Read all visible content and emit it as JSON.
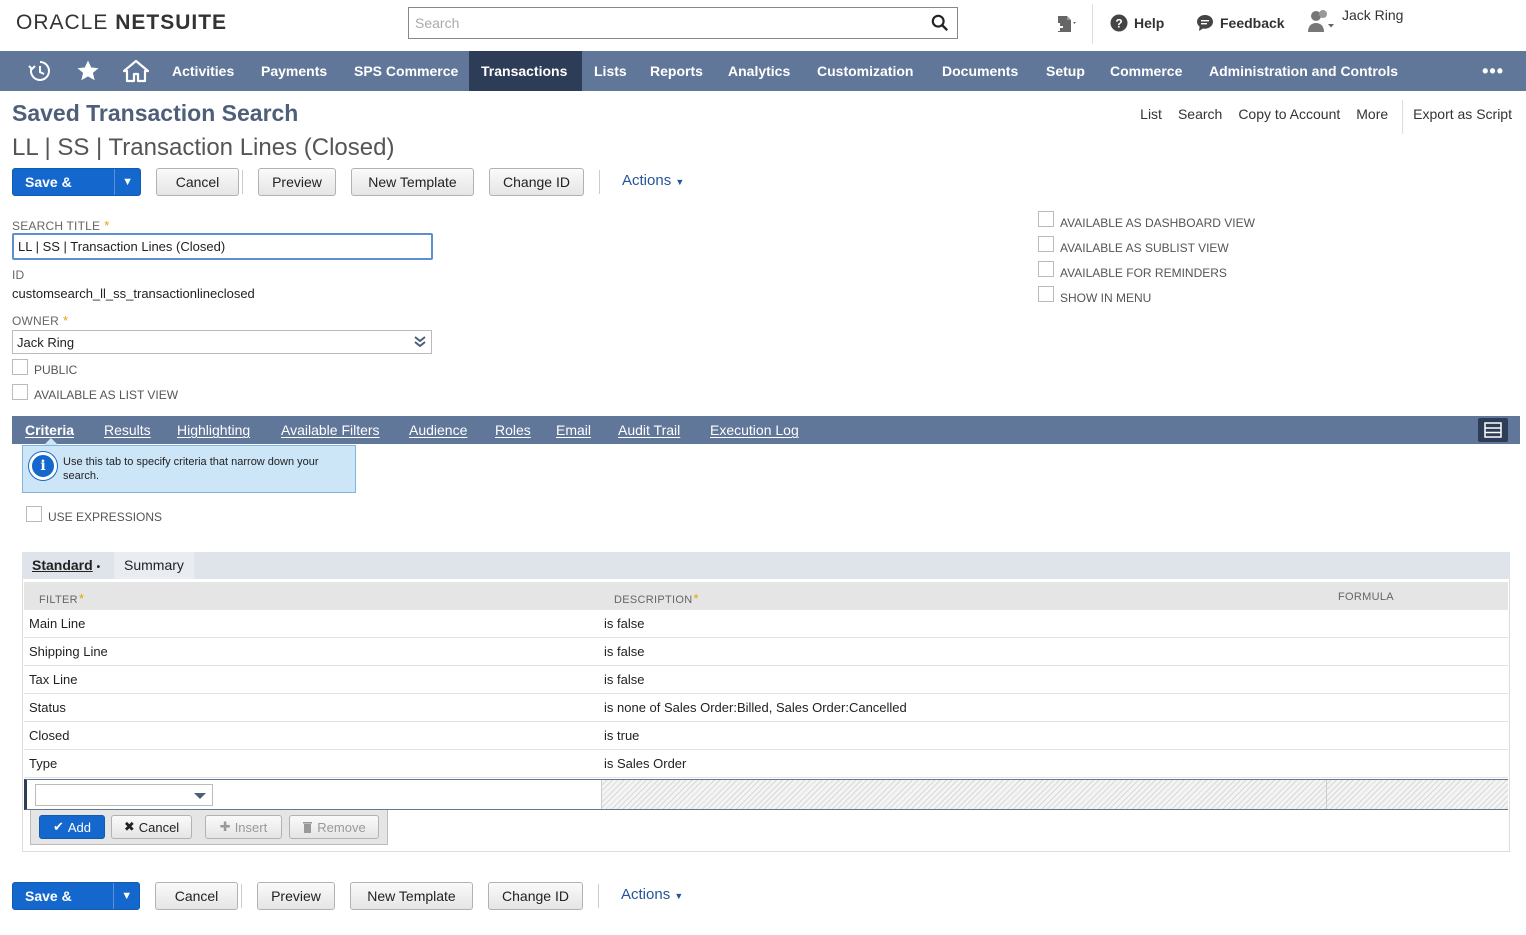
{
  "header": {
    "logo_left": "ORACLE",
    "logo_right": "NETSUITE",
    "search_placeholder": "Search",
    "help": "Help",
    "feedback": "Feedback",
    "user": "Jack Ring"
  },
  "nav": {
    "items": [
      "Activities",
      "Payments",
      "SPS Commerce",
      "Transactions",
      "Lists",
      "Reports",
      "Analytics",
      "Customization",
      "Documents",
      "Setup",
      "Commerce",
      "Administration and Controls"
    ],
    "active": "Transactions",
    "more": "•••"
  },
  "page": {
    "title": "Saved Transaction Search",
    "record_title": "LL | SS | Transaction Lines (Closed)",
    "right_links": [
      "List",
      "Search",
      "Copy to Account",
      "More",
      "Export as Script"
    ]
  },
  "buttons": {
    "save_run": "Save & Run",
    "cancel": "Cancel",
    "preview": "Preview",
    "new_template": "New Template",
    "change_id": "Change ID",
    "actions": "Actions"
  },
  "form": {
    "search_title_label": "SEARCH TITLE",
    "search_title_value": "LL | SS | Transaction Lines (Closed)",
    "id_label": "ID",
    "id_value": "customsearch_ll_ss_transactionlineclosed",
    "owner_label": "OWNER",
    "owner_value": "Jack Ring",
    "public_label": "PUBLIC",
    "list_view_label": "AVAILABLE AS LIST VIEW",
    "right_checks": [
      "AVAILABLE AS DASHBOARD VIEW",
      "AVAILABLE AS SUBLIST VIEW",
      "AVAILABLE FOR REMINDERS",
      "SHOW IN MENU"
    ]
  },
  "tabs": {
    "items": [
      "Criteria",
      "Results",
      "Highlighting",
      "Available Filters",
      "Audience",
      "Roles",
      "Email",
      "Audit Trail",
      "Execution Log"
    ],
    "active": "Criteria"
  },
  "criteria": {
    "info": "Use this tab to specify criteria that narrow down your search.",
    "use_expressions": "USE EXPRESSIONS",
    "subtabs": [
      "Standard",
      "Summary"
    ],
    "columns": [
      "FILTER",
      "DESCRIPTION",
      "FORMULA"
    ],
    "rows": [
      {
        "filter": "Main Line",
        "description": "is false"
      },
      {
        "filter": "Shipping Line",
        "description": "is false"
      },
      {
        "filter": "Tax Line",
        "description": "is false"
      },
      {
        "filter": "Status",
        "description": "is none of Sales Order:Billed, Sales Order:Cancelled"
      },
      {
        "filter": "Closed",
        "description": "is true"
      },
      {
        "filter": "Type",
        "description": "is Sales Order"
      }
    ],
    "machine_buttons": {
      "add": "Add",
      "cancel": "Cancel",
      "insert": "Insert",
      "remove": "Remove"
    }
  },
  "colors": {
    "nav_bg": "#607799",
    "nav_active": "#2d3d57",
    "primary": "#1467cc",
    "title": "#4d5f79"
  }
}
